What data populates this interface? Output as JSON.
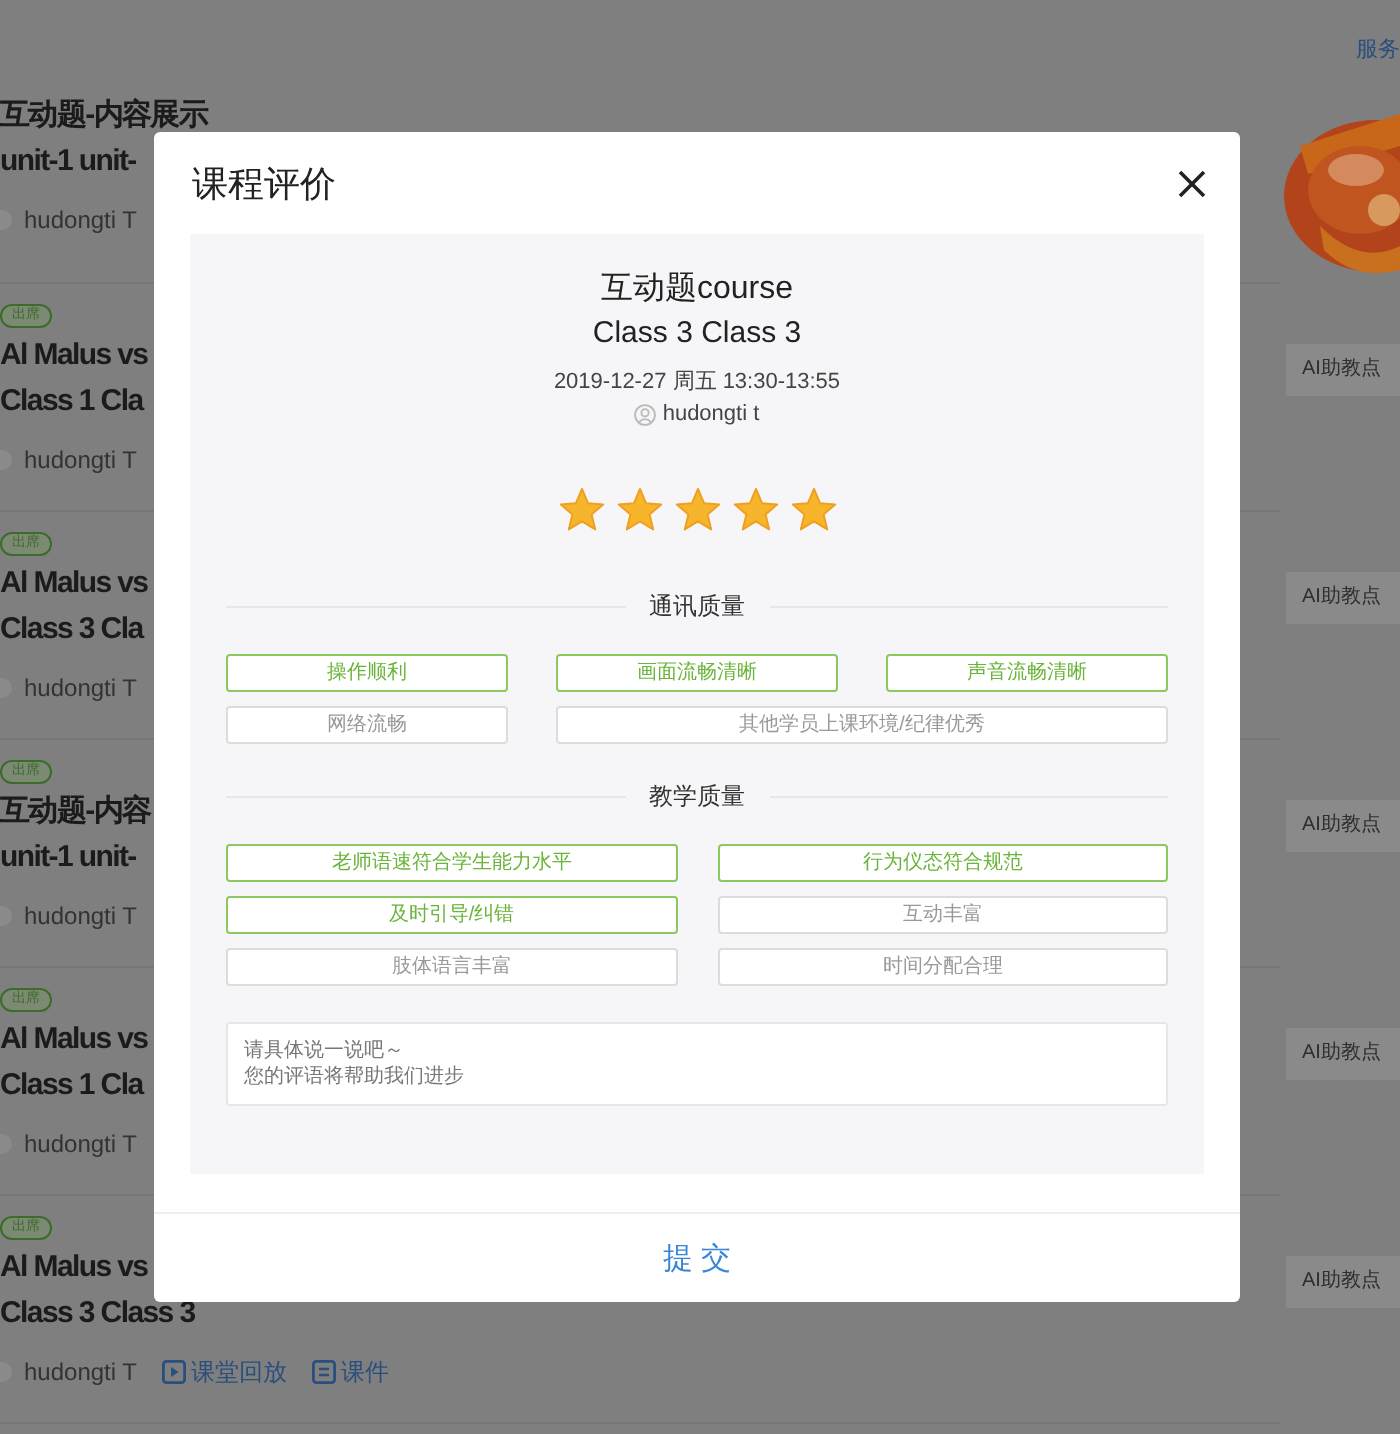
{
  "header": {
    "link": "服务"
  },
  "cards": [
    {
      "title": [
        "互动题-内容展示",
        "unit-1 unit-"
      ],
      "author": "hudongti T"
    },
    {
      "badge": "出席",
      "title": [
        "Al Malus vs",
        "Class 1 Cla"
      ],
      "author": "hudongti T"
    },
    {
      "badge": "出席",
      "title": [
        "Al Malus vs",
        "Class 3 Cla"
      ],
      "author": "hudongti T"
    },
    {
      "badge": "出席",
      "title": [
        "互动题-内容",
        "unit-1 unit-"
      ],
      "author": "hudongti T"
    },
    {
      "badge": "出席",
      "title": [
        "Al Malus vs",
        "Class 1 Cla"
      ],
      "author": "hudongti T"
    },
    {
      "badge": "出席",
      "title": [
        "Al Malus vs",
        "Class 3 Class 3"
      ],
      "author": "hudongti T",
      "actions": [
        {
          "kind": "replay",
          "label": "课堂回放"
        },
        {
          "kind": "doc",
          "label": "课件"
        }
      ]
    }
  ],
  "side_buttons": [
    "AI助教点",
    "AI助教点",
    "AI助教点",
    "AI助教点",
    "AI助教点"
  ],
  "dialog": {
    "title": "课程评价",
    "course": "互动题course",
    "class": "Class 3 Class 3",
    "time": "2019-12-27 周五 13:30-13:55",
    "teacher": "hudongti t",
    "rating": {
      "stars": 5
    },
    "sections": [
      {
        "title": "通讯质量",
        "kind": "triple",
        "tags": [
          {
            "label": "操作顺利",
            "selected": true
          },
          {
            "label": "画面流畅清晰",
            "selected": true
          },
          {
            "label": "声音流畅清晰",
            "selected": true
          },
          {
            "label": "网络流畅",
            "selected": false
          },
          {
            "label": "其他学员上课环境/纪律优秀",
            "selected": false
          }
        ]
      },
      {
        "title": "教学质量",
        "kind": "double",
        "tags": [
          {
            "label": "老师语速符合学生能力水平",
            "selected": true
          },
          {
            "label": "行为仪态符合规范",
            "selected": true
          },
          {
            "label": "及时引导/纠错",
            "selected": true
          },
          {
            "label": "互动丰富",
            "selected": false
          },
          {
            "label": "肢体语言丰富",
            "selected": false
          },
          {
            "label": "时间分配合理",
            "selected": false
          }
        ]
      }
    ],
    "comment": {
      "placeholder": [
        "请具体说一说吧～",
        "您的评语将帮助我们进步"
      ]
    },
    "submit": "提 交"
  }
}
